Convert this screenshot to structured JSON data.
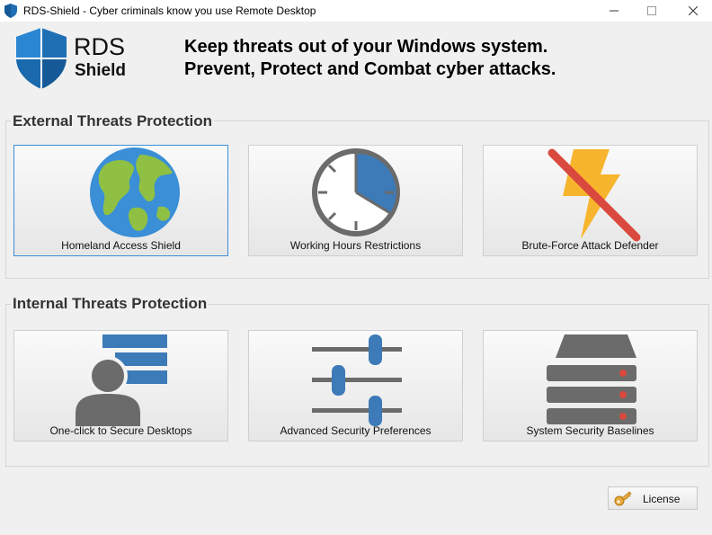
{
  "window": {
    "title": "RDS-Shield - Cyber criminals know you use Remote Desktop",
    "icon": "shield-icon",
    "controls": {
      "minimize": "minimize-icon",
      "maximize": "maximize-icon",
      "close": "close-icon"
    }
  },
  "header": {
    "logo_rds": "RDS",
    "logo_shield": "Shield",
    "tagline_line1": "Keep threats out of your Windows system.",
    "tagline_line2": "Prevent, Protect and Combat cyber attacks."
  },
  "external": {
    "title": "External Threats Protection",
    "tiles": [
      {
        "label": "Homeland Access Shield",
        "icon": "globe-icon",
        "selected": true
      },
      {
        "label": "Working Hours Restrictions",
        "icon": "clock-icon",
        "selected": false
      },
      {
        "label": "Brute-Force Attack Defender",
        "icon": "lightning-icon",
        "selected": false
      }
    ]
  },
  "internal": {
    "title": "Internal Threats Protection",
    "tiles": [
      {
        "label": "One-click to Secure Desktops",
        "icon": "user-list-icon",
        "selected": false
      },
      {
        "label": "Advanced Security Preferences",
        "icon": "sliders-icon",
        "selected": false
      },
      {
        "label": "System Security Baselines",
        "icon": "server-icon",
        "selected": false
      }
    ]
  },
  "footer": {
    "license_label": "License",
    "license_icon": "key-icon"
  },
  "colors": {
    "brand_blue": "#1f6fb5",
    "icon_blue": "#3d7ab8",
    "icon_gray": "#6b6b6b",
    "bolt_yellow": "#f7b52e",
    "strike_red": "#d9493d",
    "selected_border": "#3c8ed8"
  }
}
